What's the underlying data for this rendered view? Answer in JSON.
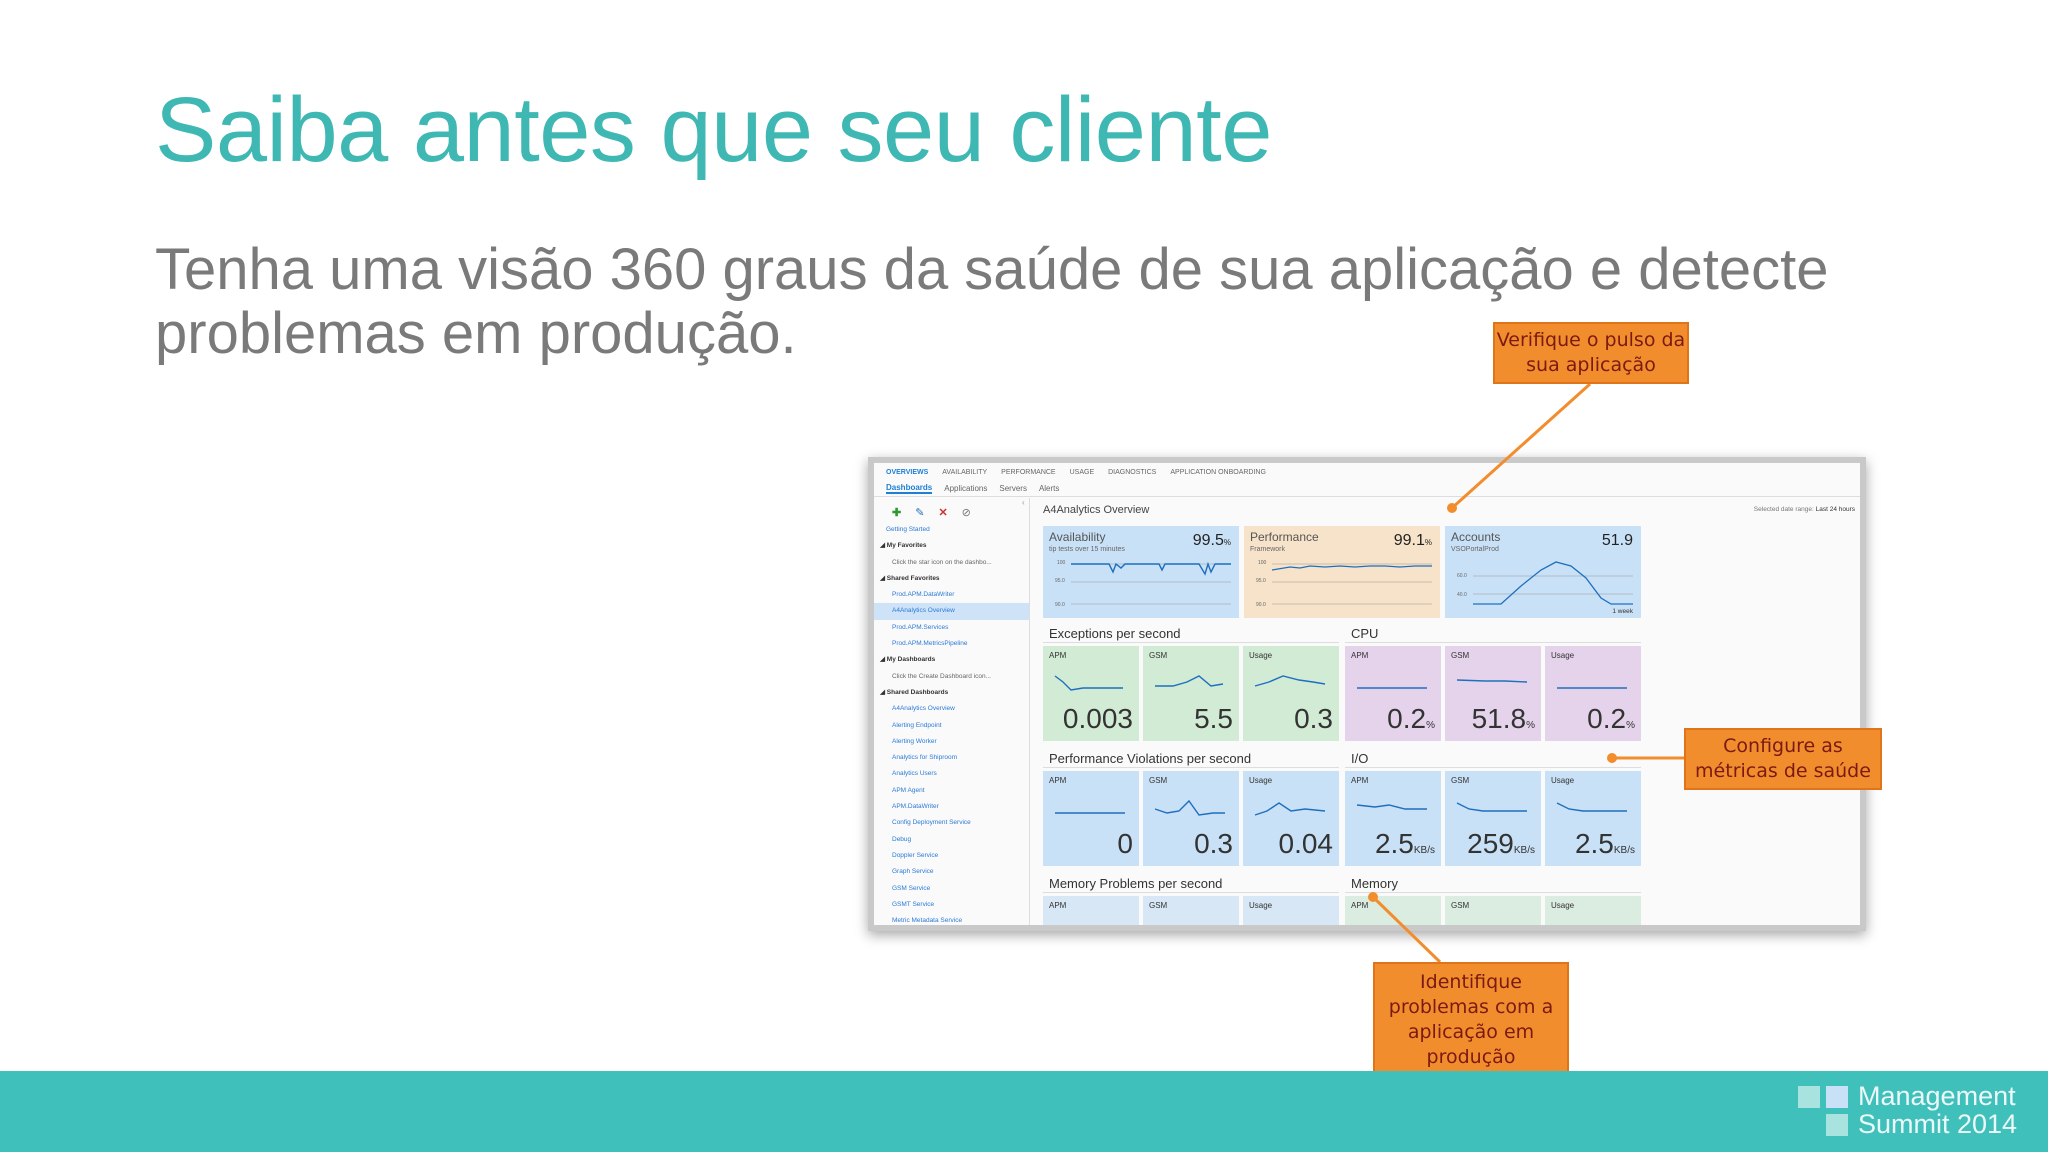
{
  "slide": {
    "title": "Saiba antes que seu cliente",
    "subtitle": "Tenha uma visão 360 graus da saúde de sua aplicação e detecte problemas em produção."
  },
  "footer": {
    "brand_line1": "Management",
    "brand_line2": "Summit 2014",
    "color": "#3fc0bb"
  },
  "callouts": {
    "pulse": "Verifique o pulso da sua aplicação",
    "metrics": "Configure as métricas de saúde",
    "problems": "Identifique problemas com a aplicação em produção",
    "color": "#f28d2e"
  },
  "screenshot": {
    "top_nav": [
      "OVERVIEWS",
      "AVAILABILITY",
      "PERFORMANCE",
      "USAGE",
      "DIAGNOSTICS",
      "APPLICATION ONBOARDING"
    ],
    "sub_nav": [
      "Dashboards",
      "Applications",
      "Servers",
      "Alerts"
    ],
    "sidebar": [
      {
        "text": "Getting Started",
        "kind": "link"
      },
      {
        "text": "◢ My Favorites",
        "kind": "head"
      },
      {
        "text": "Click the star icon on the dashbo...",
        "kind": "note"
      },
      {
        "text": "◢ Shared Favorites",
        "kind": "head"
      },
      {
        "text": "Prod.APM.DataWriter",
        "kind": "link"
      },
      {
        "text": "A4Analytics Overview",
        "kind": "link sel"
      },
      {
        "text": "Prod.APM.Services",
        "kind": "link"
      },
      {
        "text": "Prod.APM.MetricsPipeline",
        "kind": "link"
      },
      {
        "text": "◢ My Dashboards",
        "kind": "head"
      },
      {
        "text": "Click the Create Dashboard icon...",
        "kind": "note"
      },
      {
        "text": "◢ Shared Dashboards",
        "kind": "head"
      },
      {
        "text": "A4Analytics Overview",
        "kind": "link"
      },
      {
        "text": "Alerting Endpoint",
        "kind": "link"
      },
      {
        "text": "Alerting Worker",
        "kind": "link"
      },
      {
        "text": "Analytics for Shiproom",
        "kind": "link"
      },
      {
        "text": "Analytics Users",
        "kind": "link"
      },
      {
        "text": "APM Agent",
        "kind": "link"
      },
      {
        "text": "APM.DataWriter",
        "kind": "link"
      },
      {
        "text": "Config Deployment Service",
        "kind": "link"
      },
      {
        "text": "Debug",
        "kind": "link"
      },
      {
        "text": "Doppler Service",
        "kind": "link"
      },
      {
        "text": "Graph Service",
        "kind": "link"
      },
      {
        "text": "GSM Service",
        "kind": "link"
      },
      {
        "text": "GSMT Service",
        "kind": "link"
      },
      {
        "text": "Metric Metadata Service",
        "kind": "link"
      }
    ],
    "dashboard_title": "A4Analytics Overview",
    "date_range_label": "Selected date range:",
    "date_range_value": "Last 24 hours",
    "kpis": [
      {
        "label": "Availability",
        "sub": "tip tests over 15 minutes",
        "value": "99.5",
        "unit": "%",
        "axis": [
          "100",
          "95.0",
          "90.0"
        ],
        "color": "#c9e1f6",
        "foot": ""
      },
      {
        "label": "Performance",
        "sub": "Framework",
        "value": "99.1",
        "unit": "%",
        "axis": [
          "100",
          "95.0",
          "90.0"
        ],
        "color": "#f6e3c9",
        "foot": ""
      },
      {
        "label": "Accounts",
        "sub": "VSOPortalProd",
        "value": "51.9",
        "unit": "",
        "axis": [
          "60.0",
          "40.0"
        ],
        "color": "#c9e1f6",
        "foot": "1 week"
      }
    ],
    "sections": {
      "exceptions": "Exceptions per second",
      "cpu": "CPU",
      "perf_violations": "Performance Violations per second",
      "io": "I/O",
      "memory_problems": "Memory Problems per second",
      "memory": "Memory"
    },
    "tiles_row1": [
      {
        "label": "APM",
        "value": "0.003",
        "unit": ""
      },
      {
        "label": "GSM",
        "value": "5.5",
        "unit": ""
      },
      {
        "label": "Usage",
        "value": "0.3",
        "unit": ""
      },
      {
        "label": "APM",
        "value": "0.2",
        "unit": "%"
      },
      {
        "label": "GSM",
        "value": "51.8",
        "unit": "%"
      },
      {
        "label": "Usage",
        "value": "0.2",
        "unit": "%"
      }
    ],
    "tiles_row2": [
      {
        "label": "APM",
        "value": "0",
        "unit": ""
      },
      {
        "label": "GSM",
        "value": "0.3",
        "unit": ""
      },
      {
        "label": "Usage",
        "value": "0.04",
        "unit": ""
      },
      {
        "label": "APM",
        "value": "2.5",
        "unit": "KB/s"
      },
      {
        "label": "GSM",
        "value": "259",
        "unit": "KB/s"
      },
      {
        "label": "Usage",
        "value": "2.5",
        "unit": "KB/s"
      }
    ],
    "tiles_row3": [
      {
        "label": "APM"
      },
      {
        "label": "GSM"
      },
      {
        "label": "Usage"
      },
      {
        "label": "APM"
      },
      {
        "label": "GSM"
      },
      {
        "label": "Usage"
      }
    ]
  }
}
